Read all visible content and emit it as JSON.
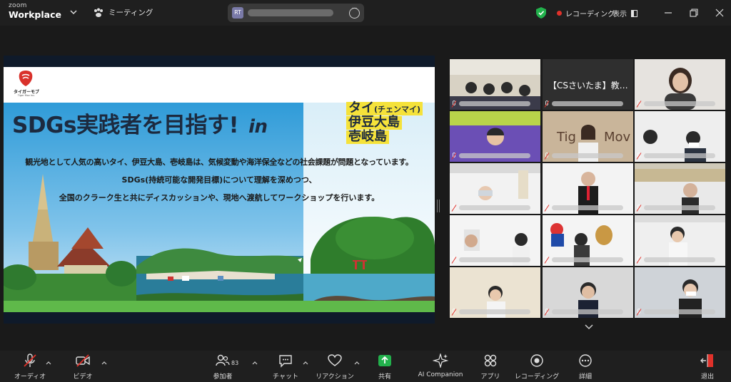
{
  "app": {
    "logo_line1": "zoom",
    "logo_line2": "Workplace"
  },
  "meeting": {
    "label": "ミーティング",
    "badge": "RT"
  },
  "status": {
    "recording": "レコーディング",
    "view": "表示"
  },
  "colors": {
    "accent_green": "#2fbf8c",
    "recording_red": "#e0312a",
    "share_green": "#22b14c",
    "muted_red": "#e0312a"
  },
  "slide": {
    "logo_text": "タイガーモブ",
    "logo_sub": "Tiger Mov Inc.",
    "headline": "SDGs実践者を目指す!",
    "headline_in": "in",
    "destinations": [
      "タイ",
      "伊豆大島",
      "壱岐島"
    ],
    "destination_note": "(チェンマイ)",
    "lead1": "観光地として人気の高いタイ、伊豆大島、壱岐島は、気候変動や海洋保全などの社会課題が問題となっています。",
    "lead2": "SDGs(持続可能な開発目標)について理解を深めつつ、",
    "lead3": "全国のクラーク生と共にディスカッションや、現地へ渡航してワークショップを行います。"
  },
  "gallery": {
    "tiles": [
      {
        "name": "",
        "text": ""
      },
      {
        "name": "",
        "text": "【CSさいたま】教…"
      },
      {
        "name": "",
        "text": ""
      },
      {
        "name": "",
        "text": ""
      },
      {
        "name": "",
        "text": ""
      },
      {
        "name": "",
        "text": ""
      },
      {
        "name": "",
        "text": ""
      },
      {
        "name": "",
        "text": ""
      },
      {
        "name": "",
        "text": ""
      },
      {
        "name": "",
        "text": ""
      },
      {
        "name": "",
        "text": ""
      },
      {
        "name": "",
        "text": ""
      },
      {
        "name": "",
        "text": ""
      },
      {
        "name": "",
        "text": ""
      },
      {
        "name": "",
        "text": ""
      }
    ]
  },
  "toolbar": {
    "audio": "オーディオ",
    "video": "ビデオ",
    "participants": "参加者",
    "participants_count": "83",
    "chat": "チャット",
    "reactions": "リアクション",
    "share": "共有",
    "ai_companion": "AI Companion",
    "apps": "アプリ",
    "recording": "レコーディング",
    "more": "詳細",
    "leave": "退出"
  }
}
